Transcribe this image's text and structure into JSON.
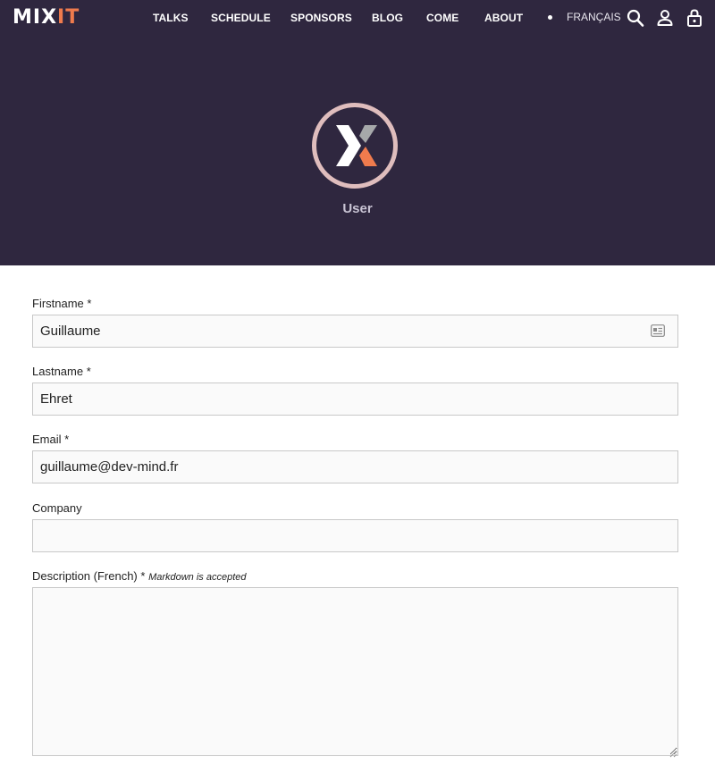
{
  "nav": {
    "logo_mix": "MIX",
    "logo_it": "IT",
    "links": [
      "TALKS",
      "SCHEDULE",
      "SPONSORS",
      "BLOG",
      "COME",
      "ABOUT"
    ],
    "language": "FRANÇAIS",
    "icons": [
      "search-icon",
      "user-icon",
      "lock-icon"
    ]
  },
  "hero": {
    "title": "User"
  },
  "form": {
    "firstname": {
      "label": "Firstname *",
      "value": "Guillaume"
    },
    "lastname": {
      "label": "Lastname *",
      "value": "Ehret"
    },
    "email": {
      "label": "Email *",
      "value": "guillaume@dev-mind.fr"
    },
    "company": {
      "label": "Company",
      "value": ""
    },
    "description": {
      "label": "Description (French) *",
      "hint": "Markdown is accepted",
      "value": ""
    }
  },
  "colors": {
    "hero_bg": "#2f273f",
    "accent": "#ef7b4d",
    "avatar_ring": "#dfbdbd"
  }
}
